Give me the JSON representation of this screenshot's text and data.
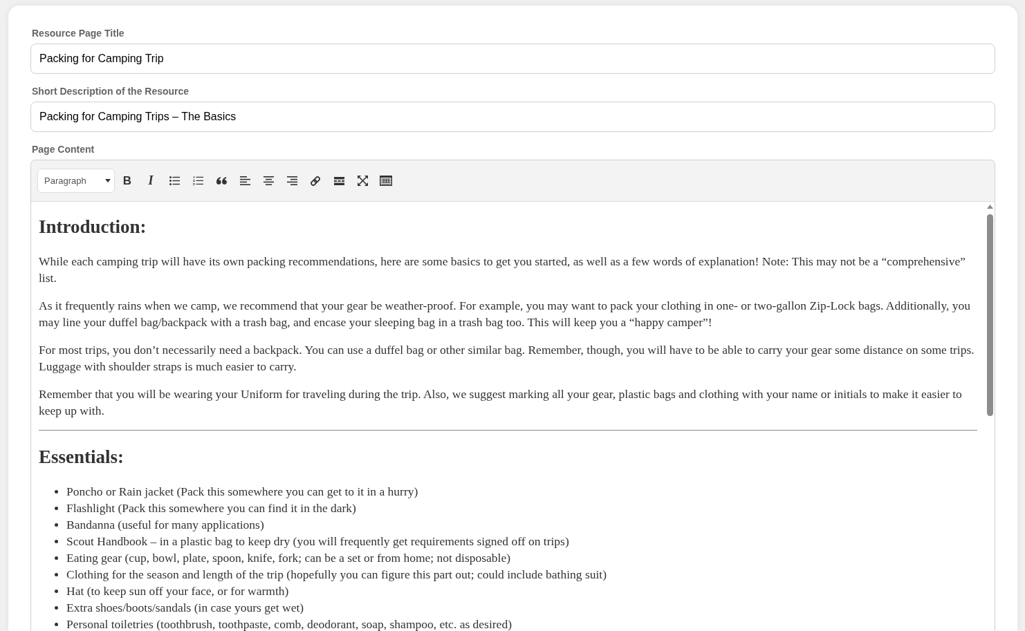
{
  "fields": [
    {
      "label": "Resource Page Title",
      "value": "Packing for Camping Trip"
    },
    {
      "label": "Short Description of the Resource",
      "value": "Packing for Camping Trips – The Basics"
    }
  ],
  "editor": {
    "label": "Page Content",
    "toolbar": {
      "format": "Paragraph",
      "buttons": [
        {
          "kind": "bold",
          "glyph": "B"
        },
        {
          "kind": "italic",
          "glyph": "I"
        },
        {
          "kind": "bullet-list"
        },
        {
          "kind": "numbered-list"
        },
        {
          "kind": "quote"
        },
        {
          "kind": "align-left"
        },
        {
          "kind": "align-center"
        },
        {
          "kind": "align-right"
        },
        {
          "kind": "link"
        },
        {
          "kind": "horizontal-rule"
        },
        {
          "kind": "fullscreen"
        },
        {
          "kind": "table"
        }
      ]
    },
    "content": [
      {
        "kind": "heading",
        "text": "Introduction:"
      },
      {
        "kind": "paragraph",
        "text": "While each camping trip will have its own packing recommendations, here are some basics to get you started, as well as a few words of explanation! Note: This may not be a “comprehensive” list."
      },
      {
        "kind": "paragraph",
        "text": "As it frequently rains when we camp, we recommend that your gear be weather-proof. For example, you may want to pack your clothing in one- or two-gallon Zip-Lock bags. Additionally, you may line your duffel bag/backpack with a trash bag, and encase your sleeping bag in a trash bag too. This will keep you a “happy camper”!"
      },
      {
        "kind": "paragraph",
        "text": "For most trips, you don’t necessarily need a backpack. You can use a duffel bag or other similar bag. Remember, though, you will have to be able to carry your gear some distance on some trips. Luggage with shoulder straps is much easier to carry."
      },
      {
        "kind": "paragraph",
        "text": "Remember that you will be wearing your Uniform for traveling during the trip. Also, we suggest marking all your gear, plastic bags and clothing with your name or initials to make it easier to keep up with."
      },
      {
        "kind": "rule"
      },
      {
        "kind": "heading",
        "text": "Essentials:"
      },
      {
        "kind": "list",
        "items": [
          "Poncho or Rain jacket (Pack this somewhere you can get to it in a hurry)",
          "Flashlight (Pack this somewhere you can find it in the dark)",
          "Bandanna (useful for many applications)",
          "Scout Handbook – in a plastic bag to keep dry (you will frequently get requirements signed off on trips)",
          "Eating gear (cup, bowl, plate, spoon, knife, fork; can be a set or from home; not disposable)",
          "Clothing for the season and length of the trip (hopefully you can figure this part out; could include bathing suit)",
          "Hat (to keep sun off your face, or for warmth)",
          "Extra shoes/boots/sandals (in case yours get wet)",
          "Personal toiletries (toothbrush, toothpaste, comb, deodorant, soap, shampoo, etc. as desired)"
        ]
      }
    ]
  }
}
